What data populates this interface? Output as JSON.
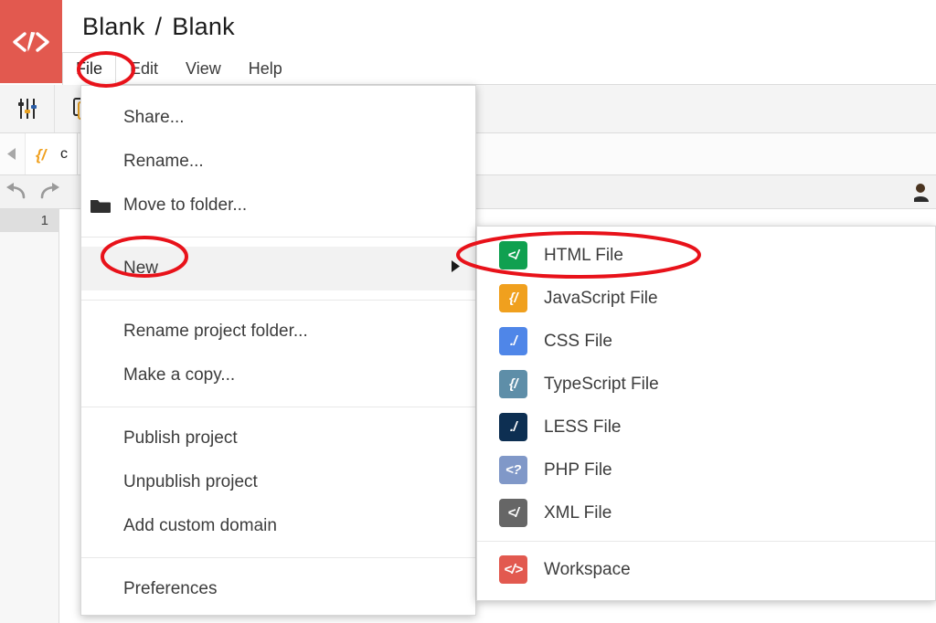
{
  "app": {
    "logo_icon": "code-pencil-logo-icon",
    "logo_color": "#e2594f"
  },
  "header": {
    "breadcrumb": {
      "project": "Blank",
      "separator": "/",
      "file": "Blank"
    }
  },
  "menubar": {
    "items": [
      {
        "label": "File",
        "active": true
      },
      {
        "label": "Edit",
        "active": false
      },
      {
        "label": "View",
        "active": false
      },
      {
        "label": "Help",
        "active": false
      }
    ]
  },
  "toolbar": {
    "buttons": [
      {
        "icon": "sliders-settings-icon"
      },
      {
        "icon": "copy-icon"
      }
    ],
    "tab_scroll_left_icon": "chevron-left-icon",
    "open_tab": {
      "icon": "javascript-file-icon",
      "label": "c"
    },
    "undo_icon": "undo-arrow-icon",
    "redo_icon": "redo-arrow-icon",
    "avatar_icon": "user-avatar-icon"
  },
  "editor": {
    "line_numbers": [
      "1"
    ],
    "active_line": "1"
  },
  "file_menu": {
    "groups": [
      {
        "items": [
          {
            "label": "Share...",
            "icon": null
          },
          {
            "label": "Rename...",
            "icon": null
          },
          {
            "label": "Move to folder...",
            "icon": "folder-icon"
          }
        ]
      },
      {
        "items": [
          {
            "label": "New",
            "icon": null,
            "highlighted": true,
            "has_submenu": true,
            "submenu_arrow_icon": "triangle-right-icon"
          }
        ]
      },
      {
        "items": [
          {
            "label": "Rename project folder...",
            "icon": null
          },
          {
            "label": "Make a copy...",
            "icon": null
          }
        ]
      },
      {
        "items": [
          {
            "label": "Publish project",
            "icon": null
          },
          {
            "label": "Unpublish project",
            "icon": null
          },
          {
            "label": "Add custom domain",
            "icon": null
          }
        ]
      },
      {
        "items": [
          {
            "label": "Preferences",
            "icon": null
          }
        ]
      }
    ]
  },
  "new_submenu": {
    "groups": [
      {
        "items": [
          {
            "label": "HTML File",
            "icon": "html-file-icon",
            "glyph": "</",
            "color": "#10a050"
          },
          {
            "label": "JavaScript File",
            "icon": "javascript-file-icon",
            "glyph": "{/",
            "color": "#f0a01e"
          },
          {
            "label": "CSS File",
            "icon": "css-file-icon",
            "glyph": "./",
            "color": "#4f86e8"
          },
          {
            "label": "TypeScript File",
            "icon": "typescript-file-icon",
            "glyph": "{/",
            "color": "#5e8ea8"
          },
          {
            "label": "LESS File",
            "icon": "less-file-icon",
            "glyph": "./",
            "color": "#0d2f52"
          },
          {
            "label": "PHP File",
            "icon": "php-file-icon",
            "glyph": "<?",
            "color": "#8098c8"
          },
          {
            "label": "XML File",
            "icon": "xml-file-icon",
            "glyph": "</",
            "color": "#666666"
          }
        ]
      },
      {
        "items": [
          {
            "label": "Workspace",
            "icon": "workspace-icon",
            "glyph": "</>",
            "color": "#e2594f"
          }
        ]
      }
    ]
  },
  "annotations": {
    "color": "#e8121a",
    "ellipses": [
      {
        "target": "File menu button"
      },
      {
        "target": "New menu item"
      },
      {
        "target": "HTML File submenu item"
      }
    ]
  }
}
